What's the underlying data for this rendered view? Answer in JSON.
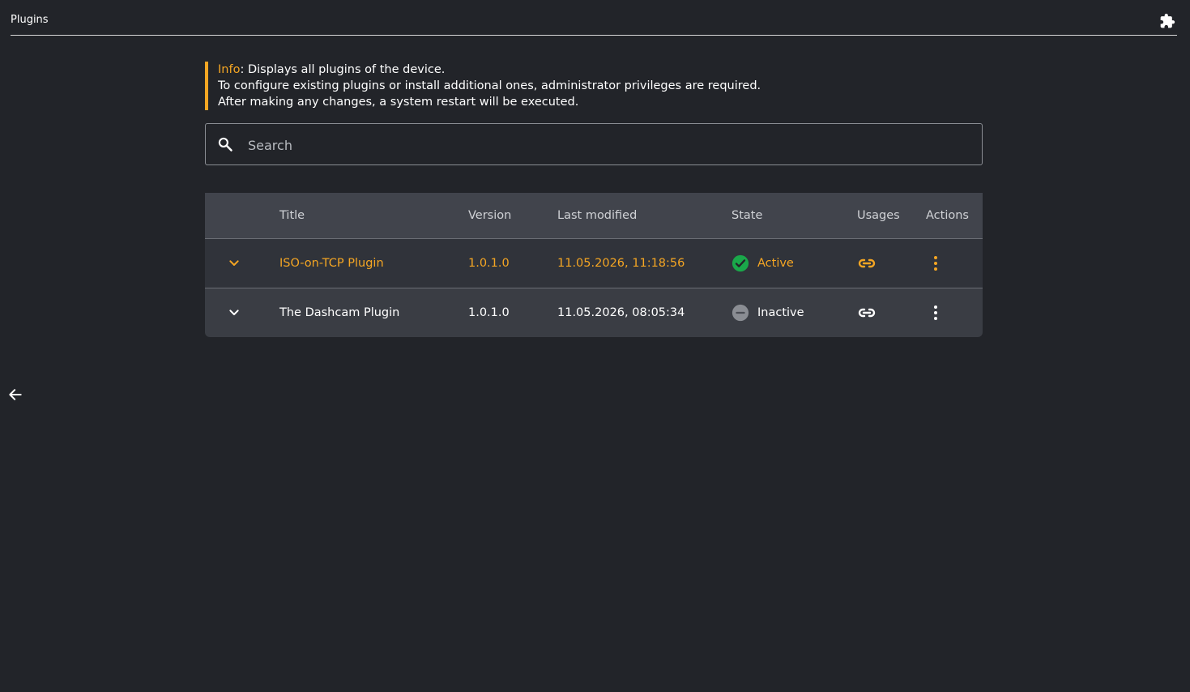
{
  "header": {
    "title": "Plugins",
    "icon": "puzzle-icon"
  },
  "info": {
    "label": "Info",
    "line1": ": Displays all plugins of the device.",
    "line2": "To configure existing plugins or install additional ones, administrator privileges are required.",
    "line3": "After making any changes, a system restart will be executed."
  },
  "search": {
    "placeholder": "Search",
    "value": ""
  },
  "table": {
    "columns": [
      "Title",
      "Version",
      "Last modified",
      "State",
      "Usages",
      "Actions"
    ],
    "rows": [
      {
        "title": "ISO-on-TCP Plugin",
        "version": "1.0.1.0",
        "last_modified": "11.05.2026, 11:18:56",
        "state": "Active"
      },
      {
        "title": "The Dashcam Plugin",
        "version": "1.0.1.0",
        "last_modified": "11.05.2026, 08:05:34",
        "state": "Inactive"
      }
    ]
  },
  "colors": {
    "accent": "#f5a623",
    "active": "#1aa84a",
    "inactive": "#8a8d93",
    "background": "#222429"
  }
}
